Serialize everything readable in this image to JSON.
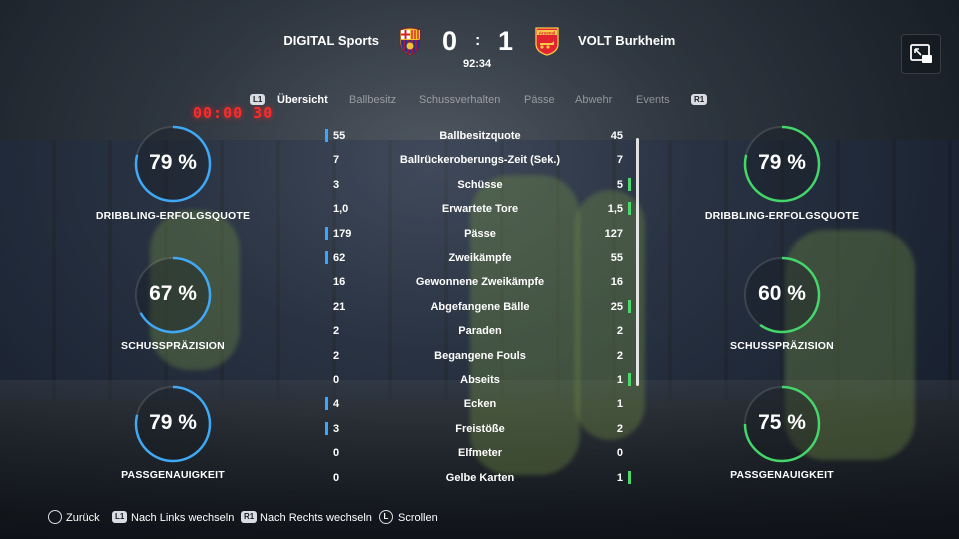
{
  "match": {
    "home_team": "DIGITAL Sports",
    "away_team": "VOLT Burkheim",
    "home_score": "0",
    "away_score": "1",
    "separator": ":",
    "time": "92:34",
    "away_crest_text": "Arsenal"
  },
  "tabs": {
    "prev_badge": "L1",
    "next_badge": "R1",
    "items": [
      "Übersicht",
      "Ballbesitz",
      "Schussverhalten",
      "Pässe",
      "Abwehr",
      "Events"
    ],
    "active": "Übersicht"
  },
  "background_clock": "00:00 30",
  "gauges": {
    "home": [
      {
        "value": 79,
        "text": "79 %",
        "label": "DRIBBLING-ERFOLGSQUOTE"
      },
      {
        "value": 67,
        "text": "67 %",
        "label": "SCHUSSPRÄZISION"
      },
      {
        "value": 79,
        "text": "79 %",
        "label": "PASSGENAUIGKEIT"
      }
    ],
    "away": [
      {
        "value": 79,
        "text": "79 %",
        "label": "DRIBBLING-ERFOLGSQUOTE"
      },
      {
        "value": 60,
        "text": "60 %",
        "label": "SCHUSSPRÄZISION"
      },
      {
        "value": 75,
        "text": "75 %",
        "label": "PASSGENAUIGKEIT"
      }
    ],
    "home_color": "#3fa9f5",
    "away_color": "#44d66a"
  },
  "stats": [
    {
      "name": "Ballbesitzquote",
      "home": "55",
      "away": "45",
      "lead": "home"
    },
    {
      "name": "Ballrückeroberungs-Zeit (Sek.)",
      "home": "7",
      "away": "7",
      "lead": "none"
    },
    {
      "name": "Schüsse",
      "home": "3",
      "away": "5",
      "lead": "away"
    },
    {
      "name": "Erwartete Tore",
      "home": "1,0",
      "away": "1,5",
      "lead": "away"
    },
    {
      "name": "Pässe",
      "home": "179",
      "away": "127",
      "lead": "home"
    },
    {
      "name": "Zweikämpfe",
      "home": "62",
      "away": "55",
      "lead": "home"
    },
    {
      "name": "Gewonnene Zweikämpfe",
      "home": "16",
      "away": "16",
      "lead": "none"
    },
    {
      "name": "Abgefangene Bälle",
      "home": "21",
      "away": "25",
      "lead": "away"
    },
    {
      "name": "Paraden",
      "home": "2",
      "away": "2",
      "lead": "none"
    },
    {
      "name": "Begangene Fouls",
      "home": "2",
      "away": "2",
      "lead": "none"
    },
    {
      "name": "Abseits",
      "home": "0",
      "away": "1",
      "lead": "away"
    },
    {
      "name": "Ecken",
      "home": "4",
      "away": "1",
      "lead": "home"
    },
    {
      "name": "Freistöße",
      "home": "3",
      "away": "2",
      "lead": "home"
    },
    {
      "name": "Elfmeter",
      "home": "0",
      "away": "0",
      "lead": "none"
    },
    {
      "name": "Gelbe Karten",
      "home": "0",
      "away": "1",
      "lead": "away"
    }
  ],
  "footer": {
    "back": "Zurück",
    "left_badge": "L1",
    "left_label": "Nach Links wechseln",
    "right_badge": "R1",
    "right_label": "Nach Rechts wechseln",
    "scroll_badge": "L",
    "scroll_label": "Scrollen"
  }
}
